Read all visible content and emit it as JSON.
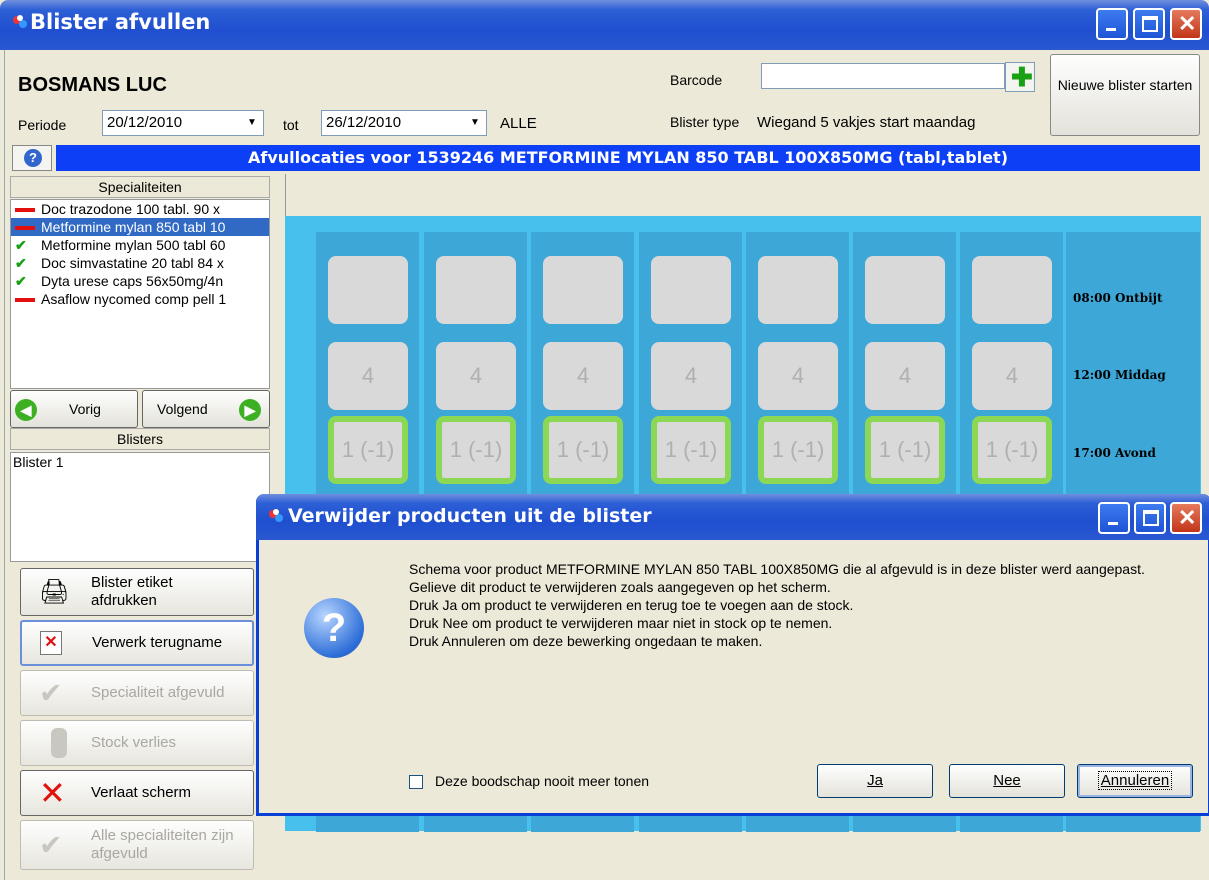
{
  "window": {
    "title": "Blister afvullen"
  },
  "header": {
    "patient_name": "BOSMANS LUC",
    "period_label": "Periode",
    "period_from": "20/12/2010",
    "to_label": "tot",
    "period_to": "26/12/2010",
    "filter_label": "ALLE",
    "barcode_label": "Barcode",
    "barcode_value": "",
    "blister_type_label": "Blister type",
    "blister_type_value": "Wiegand 5 vakjes start maandag",
    "new_blister_label": "Nieuwe blister starten"
  },
  "location_bar": "Afvullocaties voor 1539246 METFORMINE MYLAN 850 TABL 100X850MG (tabl,tablet)",
  "specialties": {
    "header": "Specialiteiten",
    "items": [
      {
        "label": "Doc trazodone 100 tabl. 90 x",
        "status": "red",
        "selected": false
      },
      {
        "label": "Metformine mylan 850 tabl 10",
        "status": "red",
        "selected": true
      },
      {
        "label": "Metformine mylan 500 tabl  60",
        "status": "check",
        "selected": false
      },
      {
        "label": "Doc simvastatine 20 tabl 84 x",
        "status": "check",
        "selected": false
      },
      {
        "label": "Dyta urese caps 56x50mg/4n",
        "status": "check",
        "selected": false
      },
      {
        "label": "Asaflow nycomed comp pell 1",
        "status": "red",
        "selected": false
      }
    ]
  },
  "nav": {
    "prev": "Vorig",
    "next": "Volgend"
  },
  "blisters": {
    "header": "Blisters",
    "items": [
      "Blister 1"
    ]
  },
  "actions": {
    "print_label": "Blister etiket afdrukken",
    "process_return": "Verwerk terugname",
    "specialty_done": "Specialiteit afgevuld",
    "stock_loss": "Stock verlies",
    "exit": "Verlaat scherm",
    "all_done": "Alle specialiteiten zijn afgevuld"
  },
  "grid": {
    "columns": 7,
    "rows": [
      {
        "time": "08:00 Ontbijt",
        "value": ""
      },
      {
        "time": "12:00 Middag",
        "value": "4"
      },
      {
        "time": "17:00 Avond",
        "value": "1 (-1)"
      }
    ]
  },
  "dialog": {
    "title": "Verwijder producten uit de blister",
    "lines": [
      "Schema voor product METFORMINE MYLAN 850 TABL 100X850MG die al afgevuld is in deze blister werd aangepast.",
      "Gelieve dit product te verwijderen zoals aangegeven op het scherm.",
      "Druk Ja om product te verwijderen en terug toe te voegen aan de stock.",
      "Druk Nee om product te verwijderen maar niet in stock op te nemen.",
      "Druk Annuleren om deze bewerking ongedaan te maken."
    ],
    "dont_show": "Deze boodschap nooit meer tonen",
    "yes": "Ja",
    "no": "Nee",
    "cancel": "Annuleren"
  },
  "colors": {
    "title_blue": "#1f4fcf",
    "bar_blue": "#0d3ff6",
    "grid_bg": "#48c0ee",
    "cell_green": "#8cd855"
  }
}
